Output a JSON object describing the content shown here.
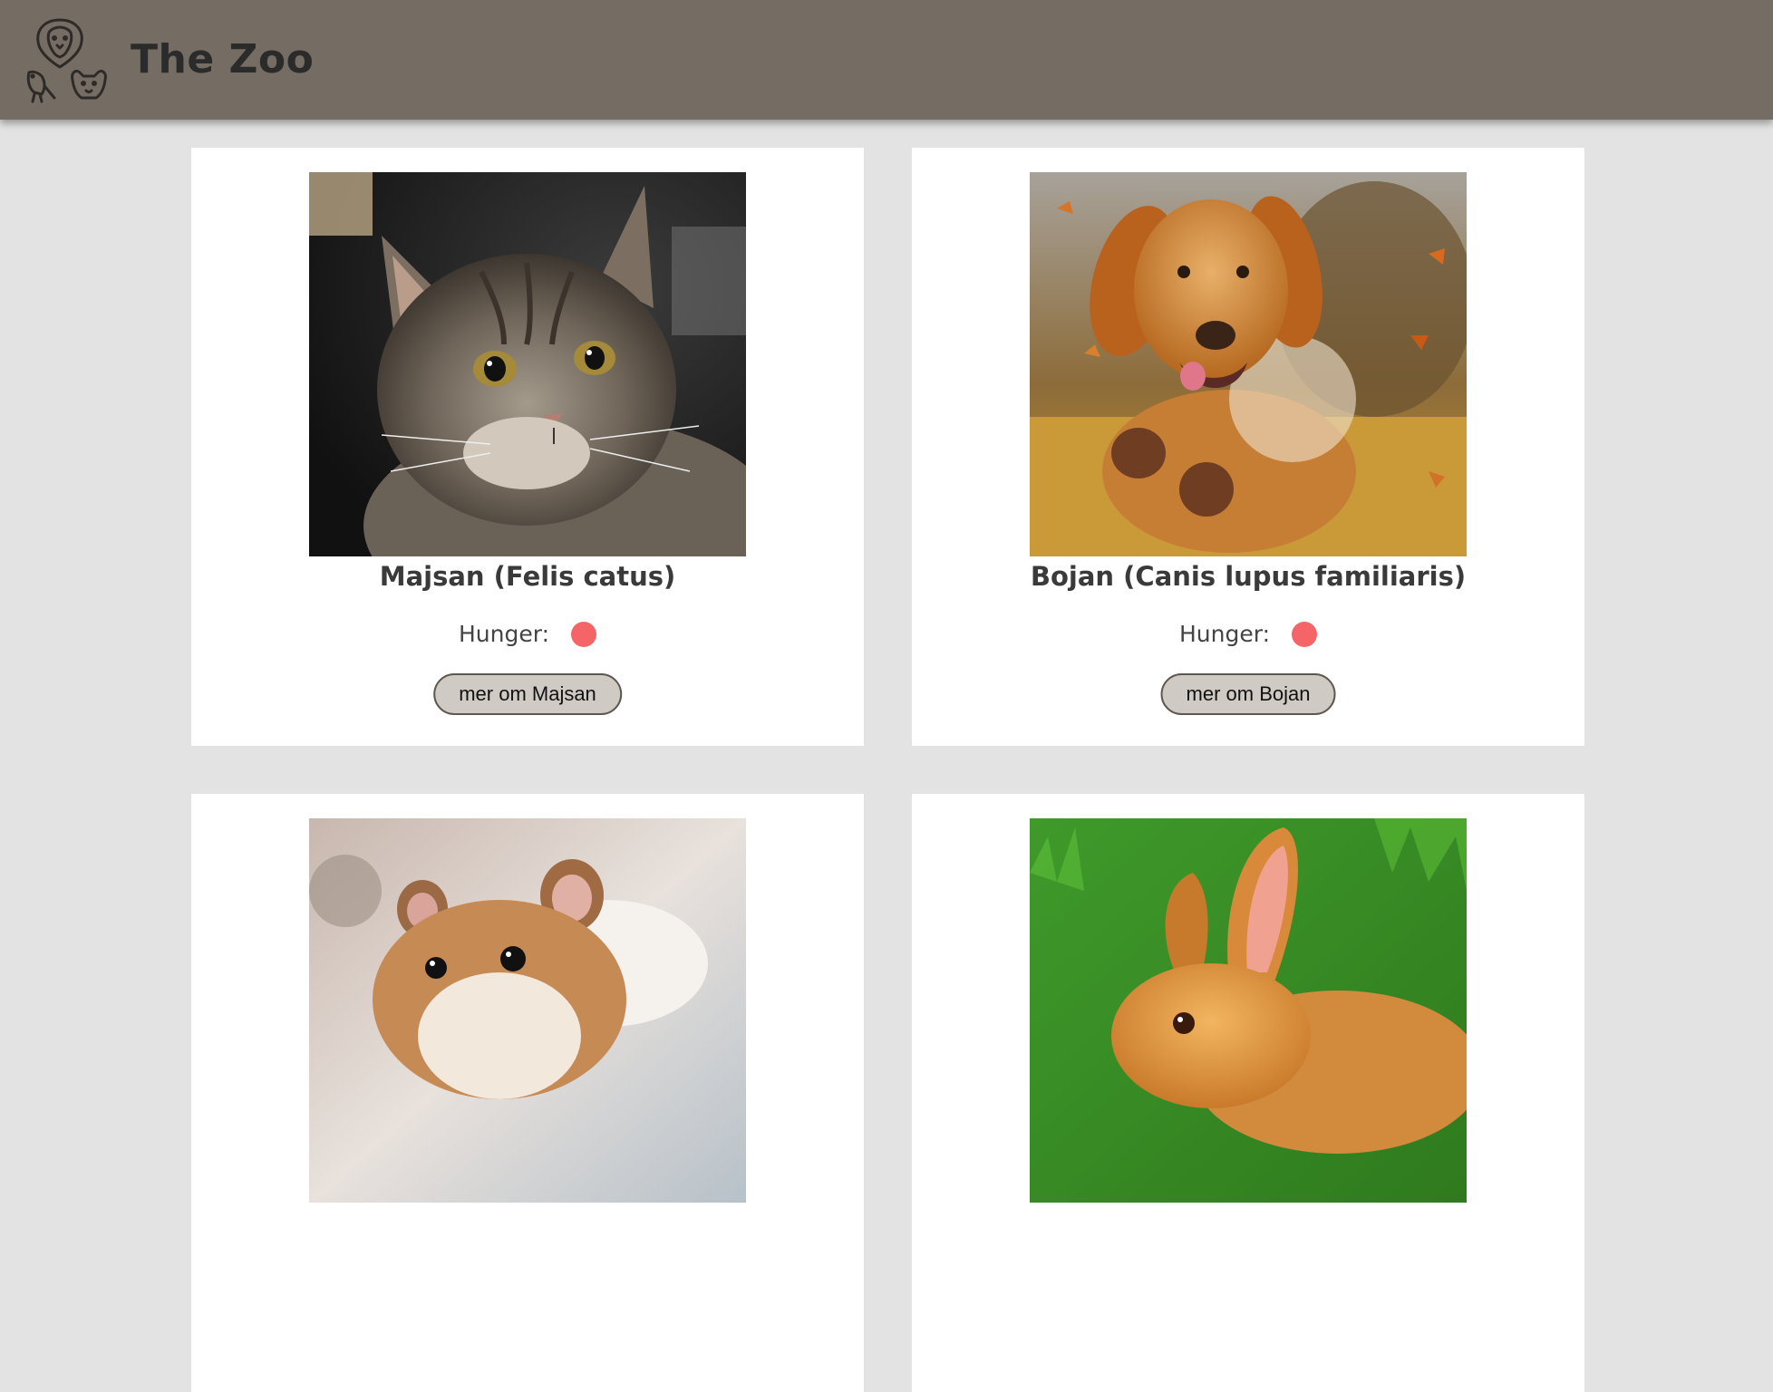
{
  "site": {
    "title": "The Zoo",
    "logo_icon": "zoo-animals-logo-icon",
    "header_color": "#756c64",
    "background_color": "#e3e3e3"
  },
  "animals": [
    {
      "name": "Majsan (Felis catus)",
      "hunger_label": "Hunger:",
      "hunger_status_color": "#f56567",
      "button_label": "mer om Majsan",
      "image": "cat-photo"
    },
    {
      "name": "Bojan (Canis lupus familiaris)",
      "hunger_label": "Hunger:",
      "hunger_status_color": "#f56567",
      "button_label": "mer om Bojan",
      "image": "dog-photo"
    },
    {
      "image": "hamster-photo"
    },
    {
      "image": "rabbit-photo"
    }
  ]
}
